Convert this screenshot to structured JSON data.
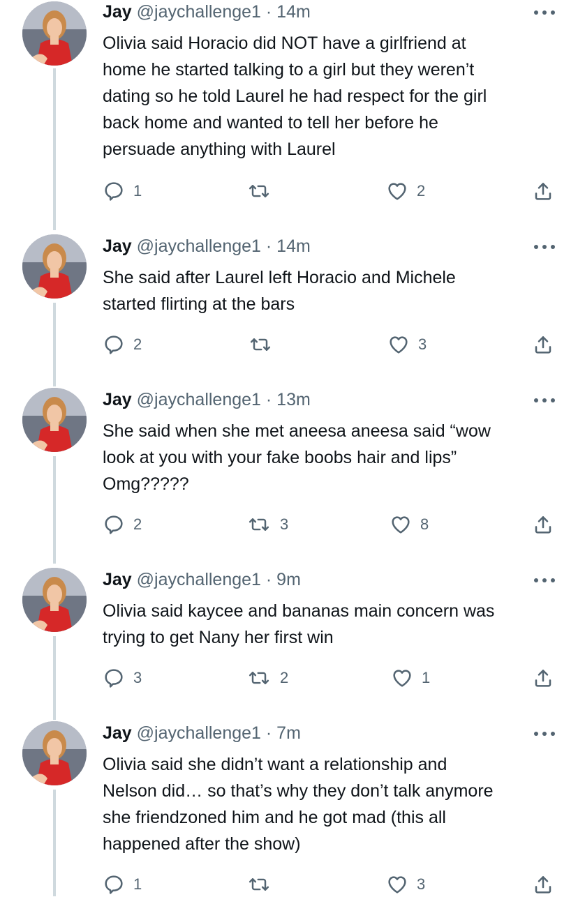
{
  "tweets": [
    {
      "name": "Jay",
      "handle": "@jaychallenge1",
      "sep": " · ",
      "time": "14m",
      "text": "Olivia said Horacio did NOT have a girlfriend at\nhome he started talking to a girl but they weren’t\ndating so he told Laurel he had respect for the girl\nback home and wanted to tell her before he\npersuade anything with Laurel",
      "replies": "1",
      "retweets": "",
      "likes": "2"
    },
    {
      "name": "Jay",
      "handle": "@jaychallenge1",
      "sep": " · ",
      "time": "14m",
      "text": "She said after Laurel left Horacio and Michele\nstarted flirting at the bars",
      "replies": "2",
      "retweets": "",
      "likes": "3"
    },
    {
      "name": "Jay",
      "handle": "@jaychallenge1",
      "sep": " · ",
      "time": "13m",
      "text": "She said when she met aneesa aneesa said “wow\nlook at you with your fake boobs hair and lips”\nOmg?????",
      "replies": "2",
      "retweets": "3",
      "likes": "8"
    },
    {
      "name": "Jay",
      "handle": "@jaychallenge1",
      "sep": " · ",
      "time": "9m",
      "text": "Olivia said kaycee and bananas main concern was\ntrying to get Nany her first win",
      "replies": "3",
      "retweets": "2",
      "likes": "1"
    },
    {
      "name": "Jay",
      "handle": "@jaychallenge1",
      "sep": " · ",
      "time": "7m",
      "text": "Olivia said she didn’t want a relationship and\nNelson did… so that’s why they don’t talk anymore\nshe friendzoned him and he got mad (this all\nhappened after the show)",
      "replies": "1",
      "retweets": "",
      "likes": "3"
    }
  ],
  "colors": {
    "text": "#0f1419",
    "secondary": "#536471",
    "thread_line": "#cfd9de"
  },
  "icons": {
    "more": "more-horizontal-icon",
    "reply": "reply-icon",
    "retweet": "retweet-icon",
    "like": "heart-icon",
    "share": "share-icon"
  }
}
